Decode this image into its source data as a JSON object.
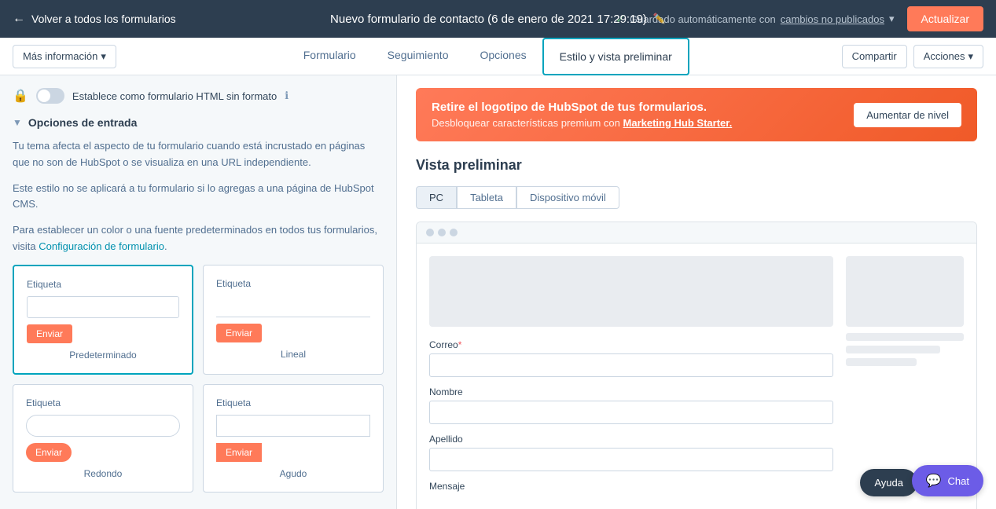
{
  "topNav": {
    "back_label": "Volver a todos los formularios",
    "title": "Nuevo formulario de contacto (6 de enero de 2021 17:29:19)",
    "saved_status": "Guardado automáticamente con",
    "saved_link": "cambios no publicados",
    "update_label": "Actualizar",
    "edit_icon": "✏️"
  },
  "secondaryNav": {
    "more_info": "Más información",
    "tabs": [
      {
        "label": "Formulario",
        "active": false
      },
      {
        "label": "Seguimiento",
        "active": false
      },
      {
        "label": "Opciones",
        "active": false
      },
      {
        "label": "Estilo y vista preliminar",
        "active": true
      }
    ],
    "share_label": "Compartir",
    "actions_label": "Acciones"
  },
  "leftPanel": {
    "toggle_label": "Establece como formulario HTML sin formato",
    "section_title": "Opciones de entrada",
    "desc1": "Tu tema afecta el aspecto de tu formulario cuando está incrustado en páginas que no son de HubSpot o se visualiza en una URL independiente.",
    "desc2": "Este estilo no se aplicará a tu formulario si lo agregas a una página de HubSpot CMS.",
    "desc3": "Para establecer un color o una fuente predeterminados en todos tus formularios, visita",
    "config_link": "Configuración de formulario",
    "styles": [
      {
        "name": "Predeterminado",
        "selected": true,
        "type": "default"
      },
      {
        "name": "Lineal",
        "selected": false,
        "type": "linear"
      },
      {
        "name": "Redondo",
        "selected": false,
        "type": "rounded"
      },
      {
        "name": "Agudo",
        "selected": false,
        "type": "sharp"
      }
    ],
    "label_text": "Etiqueta",
    "submit_text": "Enviar"
  },
  "rightPanel": {
    "banner": {
      "title": "Retire el logotipo de HubSpot de tus formularios.",
      "desc": "Desbloquear características premium con",
      "link": "Marketing Hub Starter.",
      "upgrade_label": "Aumentar de nivel"
    },
    "preview_title": "Vista preliminar",
    "device_tabs": [
      "PC",
      "Tableta",
      "Dispositivo móvil"
    ],
    "form_fields": [
      {
        "label": "Correo",
        "required": true
      },
      {
        "label": "Nombre",
        "required": false
      },
      {
        "label": "Apellido",
        "required": false
      },
      {
        "label": "Mensaje",
        "required": false
      }
    ]
  },
  "footer": {
    "chat_label": "Chat",
    "help_label": "Ayuda"
  }
}
